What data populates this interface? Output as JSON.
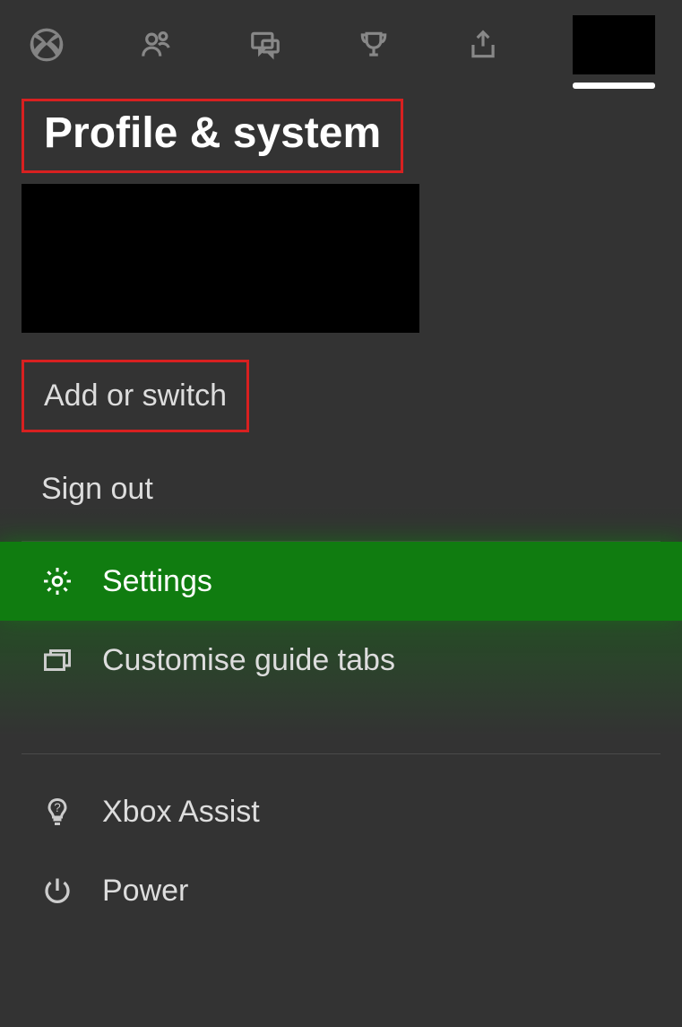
{
  "tabs": {
    "avatar_selected": true
  },
  "header": {
    "title": "Profile & system"
  },
  "account": {
    "items": [
      {
        "label": "Add or switch",
        "highlighted": true
      },
      {
        "label": "Sign out",
        "highlighted": false
      }
    ]
  },
  "menu": {
    "items": [
      {
        "label": "Settings",
        "icon": "gear-icon",
        "selected": true
      },
      {
        "label": "Customise guide tabs",
        "icon": "tabs-icon",
        "selected": false
      },
      {
        "label": "Xbox Assist",
        "icon": "lightbulb-icon",
        "selected": false
      },
      {
        "label": "Power",
        "icon": "power-icon",
        "selected": false
      }
    ]
  }
}
